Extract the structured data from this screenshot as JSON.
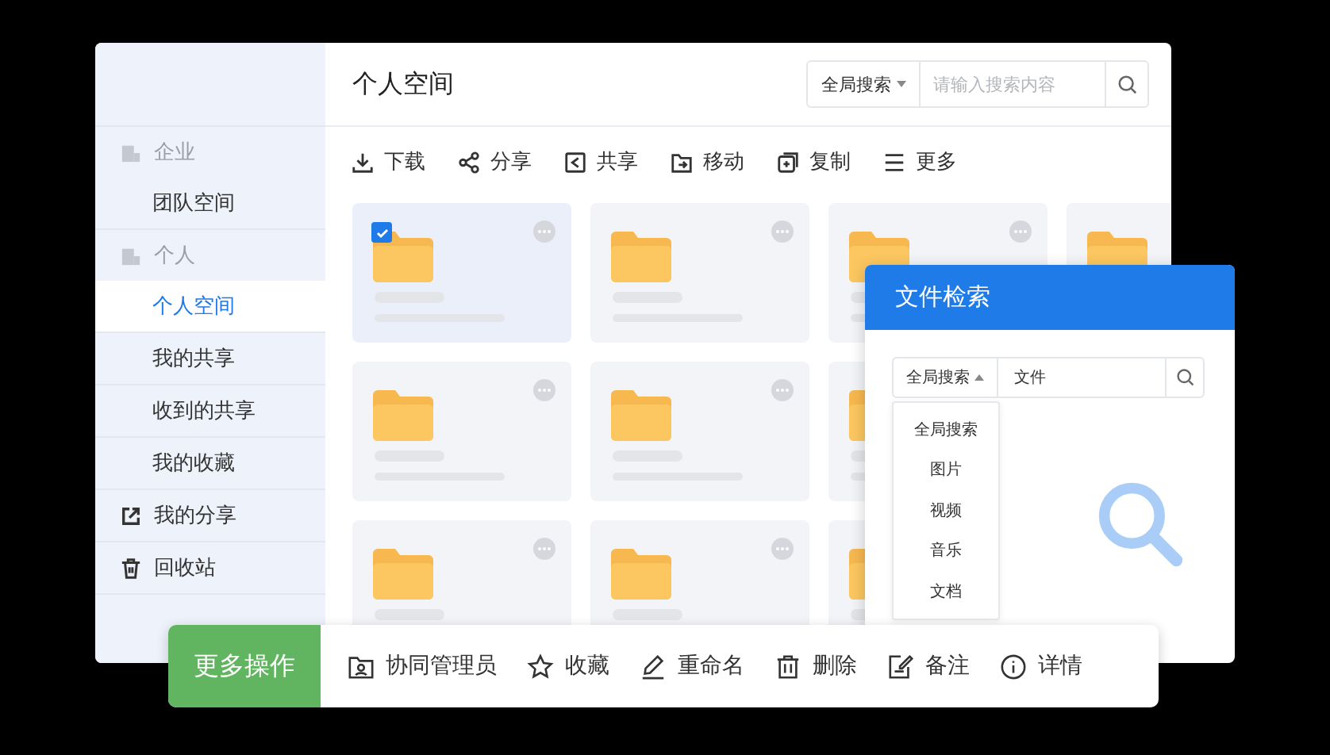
{
  "sidebar": {
    "items": [
      {
        "kind": "group",
        "label": "企业",
        "selected": false
      },
      {
        "kind": "item",
        "label": "团队空间",
        "selected": false
      },
      {
        "kind": "group",
        "label": "个人",
        "selected": false
      },
      {
        "kind": "item",
        "label": "个人空间",
        "selected": true
      },
      {
        "kind": "item",
        "label": "我的共享",
        "selected": false
      },
      {
        "kind": "item",
        "label": "收到的共享",
        "selected": false
      },
      {
        "kind": "item",
        "label": "我的收藏",
        "selected": false
      },
      {
        "kind": "link",
        "label": "我的分享",
        "selected": false
      },
      {
        "kind": "link",
        "label": "回收站",
        "selected": false
      }
    ]
  },
  "header": {
    "title": "个人空间",
    "scope": "全局搜索",
    "placeholder": "请输入搜索内容"
  },
  "toolbar": [
    "下载",
    "分享",
    "共享",
    "移动",
    "复制",
    "更多"
  ],
  "folders": [
    [
      {
        "selected": true
      },
      {
        "selected": false
      },
      {
        "selected": false
      },
      {
        "selected": false
      }
    ],
    [
      {
        "selected": false
      },
      {
        "selected": false
      },
      {
        "selected": false
      }
    ],
    [
      {
        "selected": false
      },
      {
        "selected": false
      },
      {
        "selected": false
      }
    ]
  ],
  "search_dialog": {
    "title": "文件检索",
    "scope": "全局搜索",
    "value": "文件",
    "options": [
      "全局搜索",
      "图片",
      "视频",
      "音乐",
      "文档"
    ]
  },
  "action_bar": {
    "title": "更多操作",
    "actions": [
      "协同管理员",
      "收藏",
      "重命名",
      "删除",
      "备注",
      "详情"
    ]
  }
}
